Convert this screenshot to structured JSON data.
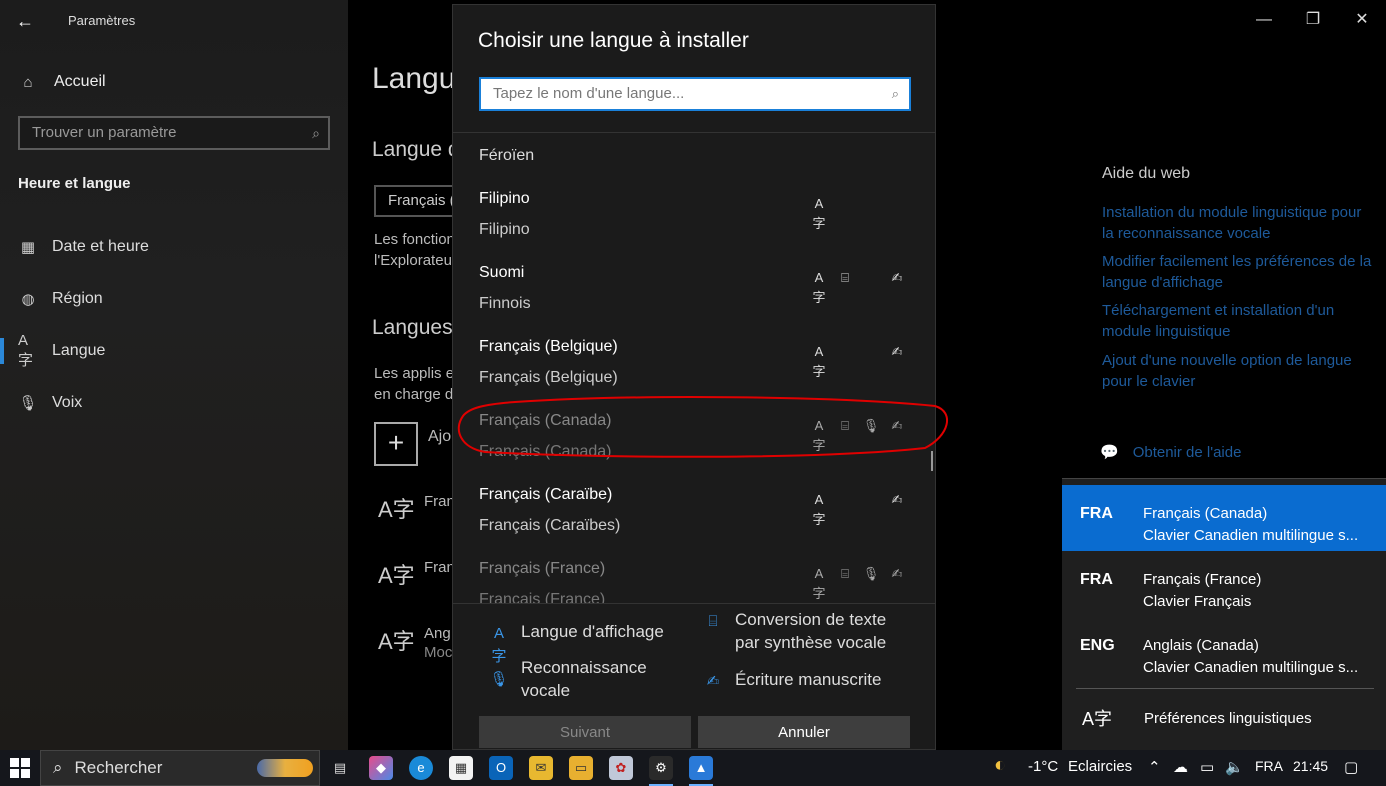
{
  "settings": {
    "app_title": "Paramètres",
    "nav": {
      "home": "Accueil",
      "search_placeholder": "Trouver un paramètre",
      "section": "Heure et langue",
      "items": [
        {
          "label": "Date et heure",
          "icon": "calendar-clock-icon"
        },
        {
          "label": "Région",
          "icon": "globe-icon"
        },
        {
          "label": "Langue",
          "icon": "language-icon"
        },
        {
          "label": "Voix",
          "icon": "microphone-icon"
        }
      ]
    },
    "main": {
      "title": "Langu",
      "display_lang_heading": "Langue d",
      "display_lang_value": "Français (C",
      "display_lang_desc_1": "Les fonction",
      "display_lang_desc_2": "l'Explorateu",
      "preferred_heading": "Langues",
      "preferred_desc_1": "Les applis et",
      "preferred_desc_2": "en charge d",
      "add_label": "Ajo",
      "list": [
        {
          "line1": "Fran",
          "line2": ""
        },
        {
          "line1": "Fran",
          "line2": ""
        },
        {
          "line1": "Ang",
          "line2": "Moc"
        }
      ]
    },
    "right": {
      "heading": "Aide du web",
      "links": [
        "Installation du module linguistique pour la reconnaissance vocale",
        "Modifier facilement les préférences de la langue d'affichage",
        "Téléchargement et installation d'un module linguistique",
        "Ajout d'une nouvelle option de langue pour le clavier"
      ],
      "help": "Obtenir de l'aide"
    }
  },
  "dialog": {
    "title": "Choisir une langue à installer",
    "search_placeholder": "Tapez le nom d'une langue...",
    "top_partial": "Féroïen",
    "languages": [
      {
        "native": "Filipino",
        "french": "Filipino",
        "features": [
          "display"
        ]
      },
      {
        "native": "Suomi",
        "french": "Finnois",
        "features": [
          "display",
          "tts",
          "handwriting"
        ]
      },
      {
        "native": "Français (Belgique)",
        "french": "Français (Belgique)",
        "features": [
          "display",
          "handwriting"
        ]
      },
      {
        "native": "Français (Canada)",
        "french": "Français (Canada)",
        "features": [
          "display",
          "tts",
          "speech",
          "handwriting"
        ]
      },
      {
        "native": "Français (Caraïbe)",
        "french": "Français (Caraïbes)",
        "features": [
          "display",
          "handwriting"
        ]
      },
      {
        "native": "Français (France)",
        "french": "Français (France)",
        "features": [
          "display",
          "tts",
          "speech",
          "handwriting"
        ]
      }
    ],
    "legend": {
      "display": "Langue d'affichage",
      "tts_1": "Conversion de texte",
      "tts_2": "par synthèse vocale",
      "speech_1": "Reconnaissance",
      "speech_2": "vocale",
      "handwriting": "Écriture manuscrite"
    },
    "buttons": {
      "next": "Suivant",
      "cancel": "Annuler"
    }
  },
  "flyout": {
    "items": [
      {
        "code": "FRA",
        "name": "Français (Canada)",
        "keyboard": "Clavier Canadien multilingue s...",
        "selected": true
      },
      {
        "code": "FRA",
        "name": "Français (France)",
        "keyboard": "Clavier Français",
        "selected": false
      },
      {
        "code": "ENG",
        "name": "Anglais (Canada)",
        "keyboard": "Clavier Canadien multilingue s...",
        "selected": false
      }
    ],
    "preferences": "Préférences linguistiques"
  },
  "taskbar": {
    "search": "Rechercher",
    "weather_temp": "-1°C",
    "weather_desc": "Eclaircies",
    "lang": "FRA",
    "time": "21:45"
  },
  "colors": {
    "accent": "#0a6cd0",
    "link": "#1e5a9a",
    "annotation": "#e00000"
  }
}
